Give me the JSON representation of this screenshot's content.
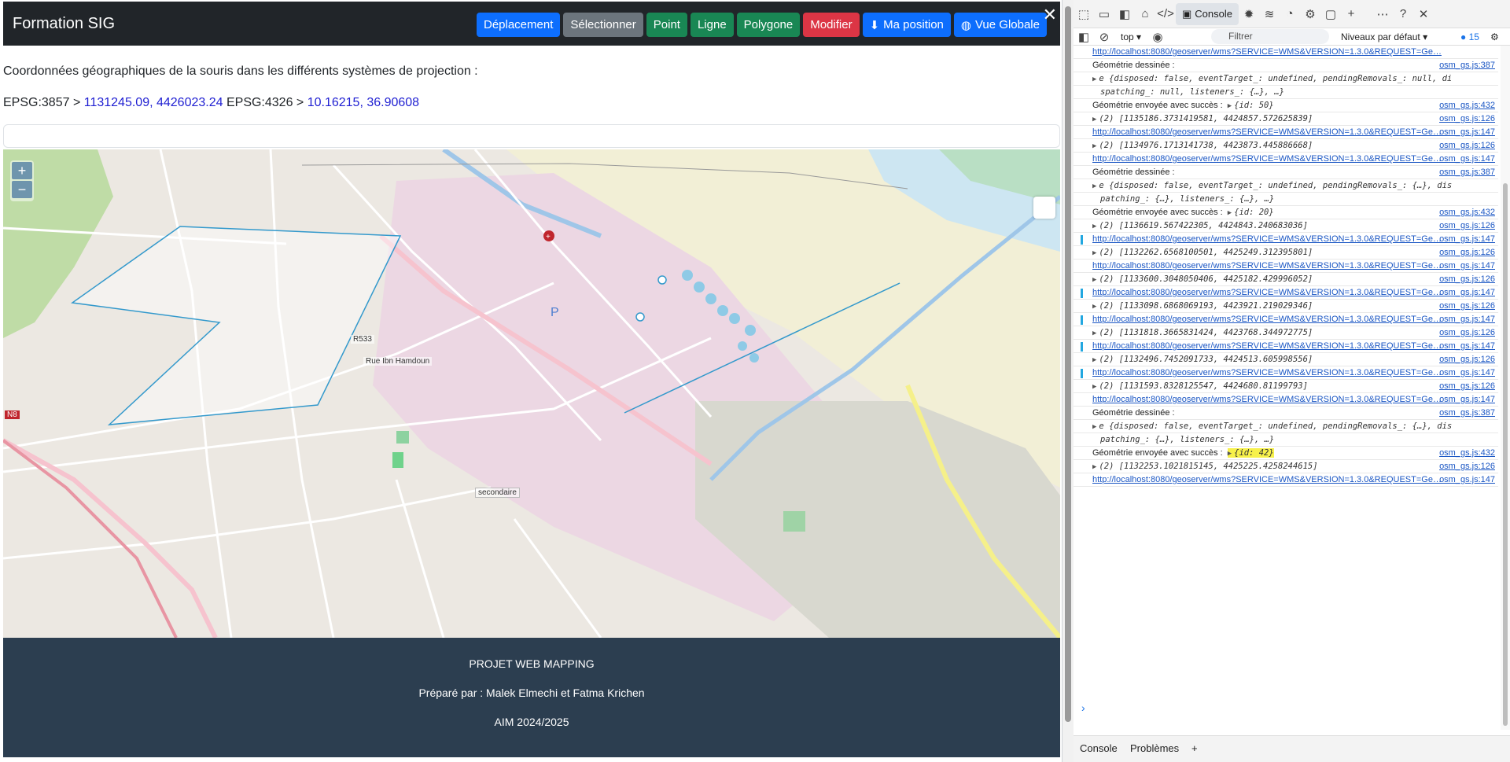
{
  "app": {
    "title": "Formation SIG",
    "buttons": [
      {
        "label": "Déplacement",
        "color": "#0d6efd"
      },
      {
        "label": "Sélectionner",
        "color": "#6c757d"
      },
      {
        "label": "Point",
        "color": "#198754"
      },
      {
        "label": "Ligne",
        "color": "#198754"
      },
      {
        "label": "Polygone",
        "color": "#198754"
      },
      {
        "label": "Modifier",
        "color": "#dc3545"
      },
      {
        "label": "Ma position",
        "color": "#0d6efd",
        "icon": "location-pin-icon"
      },
      {
        "label": "Vue Globale",
        "color": "#0d6efd",
        "icon": "globe-icon"
      }
    ],
    "close": "✕",
    "coords_title": "Coordonnées géographiques de la souris dans les différents systèmes de projection :",
    "epsg3857_label": "EPSG:3857",
    "epsg3857_value": "1131245.09, 4426023.24",
    "epsg4326_label": "EPSG:4326",
    "epsg4326_value": "10.16215, 36.90608",
    "sep": ">",
    "map": {
      "zoom_in": "+",
      "zoom_out": "−",
      "labels": {
        "road": "Rue Ibn Hamdoun",
        "route": "R533",
        "secondary": "secondaire",
        "n8": "N8"
      }
    },
    "footer": {
      "line1": "PROJET WEB MAPPING",
      "line2": "Préparé par : Malek Elmechi et Fatma Krichen",
      "line3": "AIM 2024/2025"
    }
  },
  "devtools": {
    "console_tab": "Console",
    "context": "top",
    "filter_placeholder": "Filtrer",
    "levels": "Niveaux par défaut",
    "issues_count": "15",
    "bottom_tabs": [
      "Console",
      "Problèmes"
    ],
    "logs": [
      {
        "kind": "url",
        "text": "http://localhost:8080/geoserver/wms?SERVICE=WMS&VERSION=1.3.0&REQUEST=Ge…",
        "src": ""
      },
      {
        "kind": "text",
        "text": "Géométrie dessinée :",
        "src": "osm_gs.js:387"
      },
      {
        "kind": "obj",
        "text": "e {disposed: false, eventTarget_: undefined, pendingRemovals_: null, di",
        "src": ""
      },
      {
        "kind": "obj2",
        "text": "spatching_: null, listeners_: {…}, …}",
        "src": ""
      },
      {
        "kind": "text",
        "text": "Géométrie envoyée avec succès :",
        "extra": "{id: 50}",
        "src": "osm_gs.js:432"
      },
      {
        "kind": "arr",
        "text": "(2) [1135186.3731419581, 4424857.572625839]",
        "src": "osm_gs.js:126"
      },
      {
        "kind": "url",
        "text": "http://localhost:8080/geoserver/wms?SERVICE=WMS&VERSION=1.3.0&REQUEST=Ge…",
        "src": "osm_gs.js:147"
      },
      {
        "kind": "arr",
        "text": "(2) [1134976.1713141738, 4423873.445886668]",
        "src": "osm_gs.js:126"
      },
      {
        "kind": "url",
        "text": "http://localhost:8080/geoserver/wms?SERVICE=WMS&VERSION=1.3.0&REQUEST=Ge…",
        "src": "osm_gs.js:147"
      },
      {
        "kind": "text",
        "text": "Géométrie dessinée :",
        "src": "osm_gs.js:387"
      },
      {
        "kind": "obj",
        "text": "e {disposed: false, eventTarget_: undefined, pendingRemovals_: {…}, dis",
        "src": ""
      },
      {
        "kind": "obj2",
        "text": "patching_: {…}, listeners_: {…}, …}",
        "src": ""
      },
      {
        "kind": "text",
        "text": "Géométrie envoyée avec succès :",
        "extra": "{id: 20}",
        "src": "osm_gs.js:432"
      },
      {
        "kind": "arr",
        "text": "(2) [1136619.567422305, 4424843.240683036]",
        "src": "osm_gs.js:126"
      },
      {
        "kind": "url",
        "text": "http://localhost:8080/geoserver/wms?SERVICE=WMS&VERSION=1.3.0&REQUEST=Ge…",
        "src": "osm_gs.js:147",
        "mark": true
      },
      {
        "kind": "arr",
        "text": "(2) [1132262.6568100501, 4425249.312395801]",
        "src": "osm_gs.js:126"
      },
      {
        "kind": "url",
        "text": "http://localhost:8080/geoserver/wms?SERVICE=WMS&VERSION=1.3.0&REQUEST=Ge…",
        "src": "osm_gs.js:147"
      },
      {
        "kind": "arr",
        "text": "(2) [1133600.3048050406, 4425182.429996052]",
        "src": "osm_gs.js:126"
      },
      {
        "kind": "url",
        "text": "http://localhost:8080/geoserver/wms?SERVICE=WMS&VERSION=1.3.0&REQUEST=Ge…",
        "src": "osm_gs.js:147",
        "mark": true
      },
      {
        "kind": "arr",
        "text": "(2) [1133098.6868069193, 4423921.219029346]",
        "src": "osm_gs.js:126"
      },
      {
        "kind": "url",
        "text": "http://localhost:8080/geoserver/wms?SERVICE=WMS&VERSION=1.3.0&REQUEST=Ge…",
        "src": "osm_gs.js:147",
        "mark": true
      },
      {
        "kind": "arr",
        "text": "(2) [1131818.3665831424, 4423768.344972775]",
        "src": "osm_gs.js:126"
      },
      {
        "kind": "url",
        "text": "http://localhost:8080/geoserver/wms?SERVICE=WMS&VERSION=1.3.0&REQUEST=Ge…",
        "src": "osm_gs.js:147",
        "mark": true
      },
      {
        "kind": "arr",
        "text": "(2) [1132496.7452091733, 4424513.605998556]",
        "src": "osm_gs.js:126"
      },
      {
        "kind": "url",
        "text": "http://localhost:8080/geoserver/wms?SERVICE=WMS&VERSION=1.3.0&REQUEST=Ge…",
        "src": "osm_gs.js:147",
        "mark": true
      },
      {
        "kind": "arr",
        "text": "(2) [1131593.8328125547, 4424680.81199793]",
        "src": "osm_gs.js:126"
      },
      {
        "kind": "url",
        "text": "http://localhost:8080/geoserver/wms?SERVICE=WMS&VERSION=1.3.0&REQUEST=Ge…",
        "src": "osm_gs.js:147"
      },
      {
        "kind": "text",
        "text": "Géométrie dessinée :",
        "src": "osm_gs.js:387"
      },
      {
        "kind": "obj",
        "text": "e {disposed: false, eventTarget_: undefined, pendingRemovals_: {…}, dis",
        "src": ""
      },
      {
        "kind": "obj2",
        "text": "patching_: {…}, listeners_: {…}, …}",
        "src": ""
      },
      {
        "kind": "text",
        "text": "Géométrie envoyée avec succès :",
        "extra": "{id: 42}",
        "highlight": true,
        "src": "osm_gs.js:432"
      },
      {
        "kind": "arr",
        "text": "(2) [1132253.1021815145, 4425225.4258244615]",
        "src": "osm_gs.js:126"
      },
      {
        "kind": "url",
        "text": "http://localhost:8080/geoserver/wms?SERVICE=WMS&VERSION=1.3.0&REQUEST=Ge…",
        "src": "osm_gs.js:147"
      }
    ]
  }
}
